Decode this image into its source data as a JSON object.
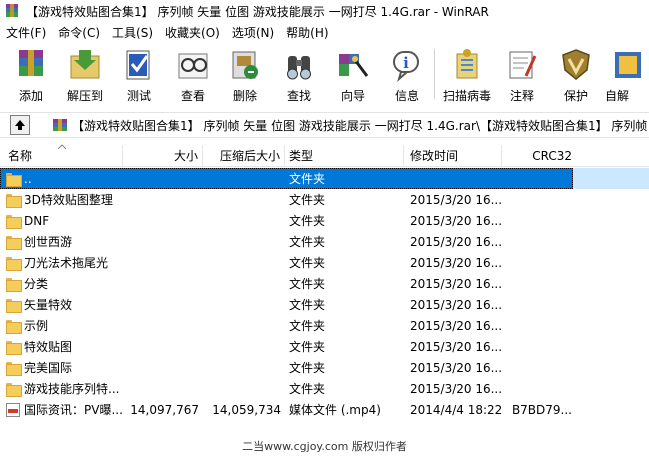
{
  "window": {
    "title": "【游戏特效贴图合集1】 序列帧 矢量 位图 游戏技能展示 一网打尽 1.4G.rar - WinRAR"
  },
  "menu": [
    {
      "label": "文件(F)"
    },
    {
      "label": "命令(C)"
    },
    {
      "label": "工具(S)"
    },
    {
      "label": "收藏夹(O)"
    },
    {
      "label": "选项(N)"
    },
    {
      "label": "帮助(H)"
    }
  ],
  "toolbar": [
    {
      "label": "添加",
      "icon": "add-archive-icon"
    },
    {
      "label": "解压到",
      "icon": "extract-to-icon"
    },
    {
      "label": "测试",
      "icon": "test-icon"
    },
    {
      "label": "查看",
      "icon": "view-icon"
    },
    {
      "label": "删除",
      "icon": "delete-icon"
    },
    {
      "label": "查找",
      "icon": "find-icon"
    },
    {
      "label": "向导",
      "icon": "wizard-icon"
    },
    {
      "label": "信息",
      "icon": "info-icon"
    },
    {
      "label": "扫描病毒",
      "icon": "virus-scan-icon"
    },
    {
      "label": "注释",
      "icon": "comment-icon"
    },
    {
      "label": "保护",
      "icon": "protect-icon"
    },
    {
      "label": "自解",
      "icon": "sfx-icon"
    }
  ],
  "path": {
    "text": "【游戏特效贴图合集1】 序列帧 矢量 位图 游戏技能展示 一网打尽 1.4G.rar\\【游戏特效贴图合集1】 序列帧"
  },
  "columns": {
    "name": "名称",
    "size": "大小",
    "packed": "压缩后大小",
    "type": "类型",
    "modified": "修改时间",
    "crc": "CRC32"
  },
  "rows": [
    {
      "name": "..",
      "size": "",
      "packed": "",
      "type": "文件夹",
      "modified": "",
      "crc": "",
      "kind": "folder",
      "selected": true
    },
    {
      "name": "3D特效贴图整理",
      "size": "",
      "packed": "",
      "type": "文件夹",
      "modified": "2015/3/20 16...",
      "crc": "",
      "kind": "folder"
    },
    {
      "name": "DNF",
      "size": "",
      "packed": "",
      "type": "文件夹",
      "modified": "2015/3/20 16...",
      "crc": "",
      "kind": "folder"
    },
    {
      "name": "创世西游",
      "size": "",
      "packed": "",
      "type": "文件夹",
      "modified": "2015/3/20 16...",
      "crc": "",
      "kind": "folder"
    },
    {
      "name": "刀光法术拖尾光",
      "size": "",
      "packed": "",
      "type": "文件夹",
      "modified": "2015/3/20 16...",
      "crc": "",
      "kind": "folder"
    },
    {
      "name": "分类",
      "size": "",
      "packed": "",
      "type": "文件夹",
      "modified": "2015/3/20 16...",
      "crc": "",
      "kind": "folder"
    },
    {
      "name": "矢量特效",
      "size": "",
      "packed": "",
      "type": "文件夹",
      "modified": "2015/3/20 16...",
      "crc": "",
      "kind": "folder"
    },
    {
      "name": "示例",
      "size": "",
      "packed": "",
      "type": "文件夹",
      "modified": "2015/3/20 16...",
      "crc": "",
      "kind": "folder"
    },
    {
      "name": "特效贴图",
      "size": "",
      "packed": "",
      "type": "文件夹",
      "modified": "2015/3/20 16...",
      "crc": "",
      "kind": "folder"
    },
    {
      "name": "完美国际",
      "size": "",
      "packed": "",
      "type": "文件夹",
      "modified": "2015/3/20 16...",
      "crc": "",
      "kind": "folder"
    },
    {
      "name": "游戏技能序列特...",
      "size": "",
      "packed": "",
      "type": "文件夹",
      "modified": "2015/3/20 16...",
      "crc": "",
      "kind": "folder"
    },
    {
      "name": "国际资讯：PV曝...",
      "size": "14,097,767",
      "packed": "14,059,734",
      "type": "媒体文件 (.mp4)",
      "modified": "2014/4/4 18:22",
      "crc": "B7BD79...",
      "kind": "file"
    }
  ],
  "watermark": {
    "text": "二当www.cgjoy.com 版权归作者"
  }
}
